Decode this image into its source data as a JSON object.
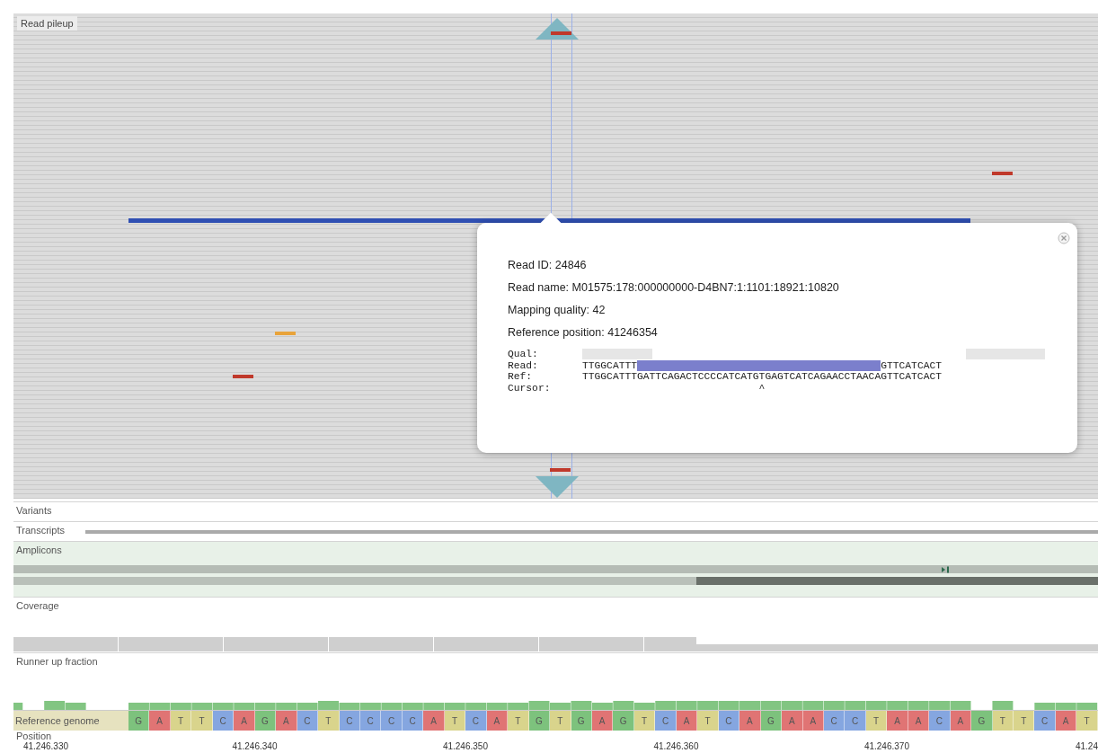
{
  "pileup": {
    "label": "Read pileup"
  },
  "popup": {
    "lines": [
      "Read ID: 24846",
      "Read name: M01575:178:000000000-D4BN7:1:1101:18921:10820",
      "Mapping quality: 42",
      "Reference position: 41246354"
    ],
    "qual_label": "Qual:",
    "read": {
      "label": "Read:",
      "prefix": "TTGGCATTT",
      "suffix": "GTTCATCACT"
    },
    "ref": {
      "label": "Ref:",
      "sequence": "TTGGCATTTGATTCAGACTCCCCATCATGTGAGTCATCAGAACCTAACAGTTCATCACT"
    },
    "cursor": {
      "label": "Cursor:",
      "value": "                             ^"
    }
  },
  "tracks": [
    {
      "kind": "variants",
      "label": "Variants"
    },
    {
      "kind": "transcripts",
      "label": "Transcripts"
    },
    {
      "kind": "amplicons",
      "label": "Amplicons"
    },
    {
      "kind": "coverage",
      "label": "Coverage"
    },
    {
      "kind": "runner",
      "label": "Runner up fraction"
    }
  ],
  "reference": {
    "label": "Reference genome",
    "bases": [
      {
        "base": "G",
        "color": "#7dc27d"
      },
      {
        "base": "A",
        "color": "#e07474"
      },
      {
        "base": "T",
        "color": "#d9d48c"
      },
      {
        "base": "T",
        "color": "#d9d48c"
      },
      {
        "base": "C",
        "color": "#85a6e0"
      },
      {
        "base": "A",
        "color": "#e07474"
      },
      {
        "base": "G",
        "color": "#7dc27d"
      },
      {
        "base": "A",
        "color": "#e07474"
      },
      {
        "base": "C",
        "color": "#85a6e0"
      },
      {
        "base": "T",
        "color": "#d9d48c"
      },
      {
        "base": "C",
        "color": "#85a6e0"
      },
      {
        "base": "C",
        "color": "#85a6e0"
      },
      {
        "base": "C",
        "color": "#85a6e0"
      },
      {
        "base": "C",
        "color": "#85a6e0"
      },
      {
        "base": "A",
        "color": "#e07474"
      },
      {
        "base": "T",
        "color": "#d9d48c"
      },
      {
        "base": "C",
        "color": "#85a6e0"
      },
      {
        "base": "A",
        "color": "#e07474"
      },
      {
        "base": "T",
        "color": "#d9d48c"
      },
      {
        "base": "G",
        "color": "#7dc27d"
      },
      {
        "base": "T",
        "color": "#d9d48c"
      },
      {
        "base": "G",
        "color": "#7dc27d"
      },
      {
        "base": "A",
        "color": "#e07474"
      },
      {
        "base": "G",
        "color": "#7dc27d"
      },
      {
        "base": "T",
        "color": "#d9d48c"
      },
      {
        "base": "C",
        "color": "#85a6e0"
      },
      {
        "base": "A",
        "color": "#e07474"
      },
      {
        "base": "T",
        "color": "#d9d48c"
      },
      {
        "base": "C",
        "color": "#85a6e0"
      },
      {
        "base": "A",
        "color": "#e07474"
      },
      {
        "base": "G",
        "color": "#7dc27d"
      },
      {
        "base": "A",
        "color": "#e07474"
      },
      {
        "base": "A",
        "color": "#e07474"
      },
      {
        "base": "C",
        "color": "#85a6e0"
      },
      {
        "base": "C",
        "color": "#85a6e0"
      },
      {
        "base": "T",
        "color": "#d9d48c"
      },
      {
        "base": "A",
        "color": "#e07474"
      },
      {
        "base": "A",
        "color": "#e07474"
      },
      {
        "base": "C",
        "color": "#85a6e0"
      },
      {
        "base": "A",
        "color": "#e07474"
      },
      {
        "base": "G",
        "color": "#7dc27d"
      },
      {
        "base": "T",
        "color": "#d9d48c"
      },
      {
        "base": "T",
        "color": "#d9d48c"
      },
      {
        "base": "C",
        "color": "#85a6e0"
      },
      {
        "base": "A",
        "color": "#e07474"
      },
      {
        "base": "T",
        "color": "#d9d48c"
      }
    ]
  },
  "position": {
    "label": "Position",
    "ticks": [
      "41.246.330",
      "41.246.340",
      "41.246.350",
      "41.246.360",
      "41.246.370",
      "41.24"
    ]
  }
}
